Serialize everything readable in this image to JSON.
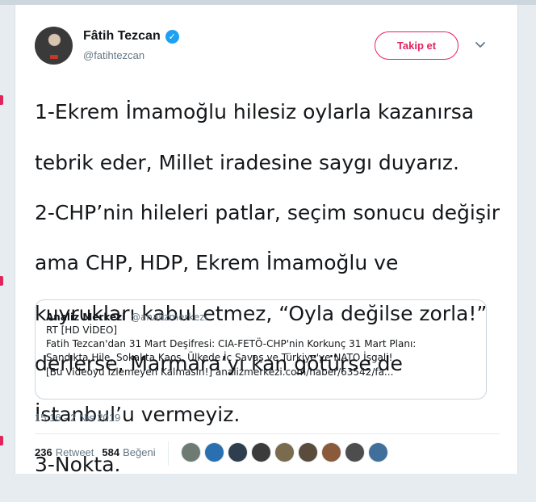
{
  "author": {
    "name": "Fâtih Tezcan",
    "handle": "@fatihtezcan",
    "verified": true
  },
  "follow_button": {
    "label": "Takip et"
  },
  "tweet": {
    "lines": [
      "1-Ekrem İmamoğlu hilesiz oylarla kazanırsa",
      "tebrik eder, Millet iradesine saygı duyarız.",
      "2-CHP’nin hileleri patlar, seçim sonucu değişir",
      "ama CHP, HDP, Ekrem İmamoğlu ve",
      "kuyrukları kabul etmez, “Oyla değilse zorla!”",
      "derlerse, Marmara’yı kan götürse de",
      "İstanbul’u vermeyiz.",
      "3-Nokta."
    ]
  },
  "quoted_tweet": {
    "name": "Analiz Merkezi",
    "handle": "@analizmerkezi",
    "lines": [
      "RT [HD VİDEO]",
      "Fatih Tezcan'dan 31 Mart Deşifresi: CIA-FETÖ-CHP'nin Korkunç 31 Mart Planı:",
      "Sandıkta Hile, Sokakta Kaos, Ülkede İç Savaş ve Türkiye'ye NATO İşgali!",
      "[Bu Videoyu İzlemeyen Kalmasın!] analizmerkezi.com/haber/63542/fa..."
    ]
  },
  "timestamp": "15:16 - 2 Nis 2019",
  "stats": {
    "retweet_count": "236",
    "retweet_label": "Retweet",
    "like_count": "584",
    "like_label": "Beğeni"
  },
  "liker_avatar_colors": [
    "#6d7b73",
    "#2a6fb0",
    "#2f3e4f",
    "#3b3b3b",
    "#7a6a4e",
    "#5a4b3c",
    "#8a5a3a",
    "#4d4d4d",
    "#3f6f9a"
  ],
  "colors": {
    "accent": "#e0245e",
    "verified": "#1da1f2",
    "text": "#14171a",
    "muted": "#657786",
    "background": "#e6ecf0"
  }
}
